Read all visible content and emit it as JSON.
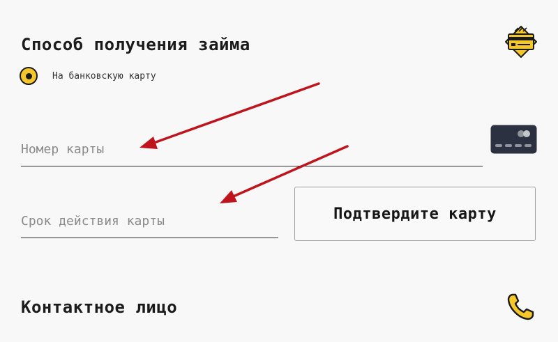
{
  "loan_method": {
    "title": "Способ получения займа",
    "option_bank_card": "На банковскую карту"
  },
  "card_number": {
    "placeholder": "Номер карты",
    "value": ""
  },
  "card_expiry": {
    "placeholder": "Срок действия карты",
    "value": ""
  },
  "confirm_button_label": "Подтвердите карту",
  "contact": {
    "title": "Контактное лицо"
  },
  "icons": {
    "loan_method": "credit-card-banner-icon",
    "card_number": "credit-card-icon",
    "contact": "phone-icon"
  },
  "colors": {
    "accent_yellow": "#f6c72a",
    "annotation_arrow": "#c0141c",
    "card_dark": "#2b3140"
  }
}
